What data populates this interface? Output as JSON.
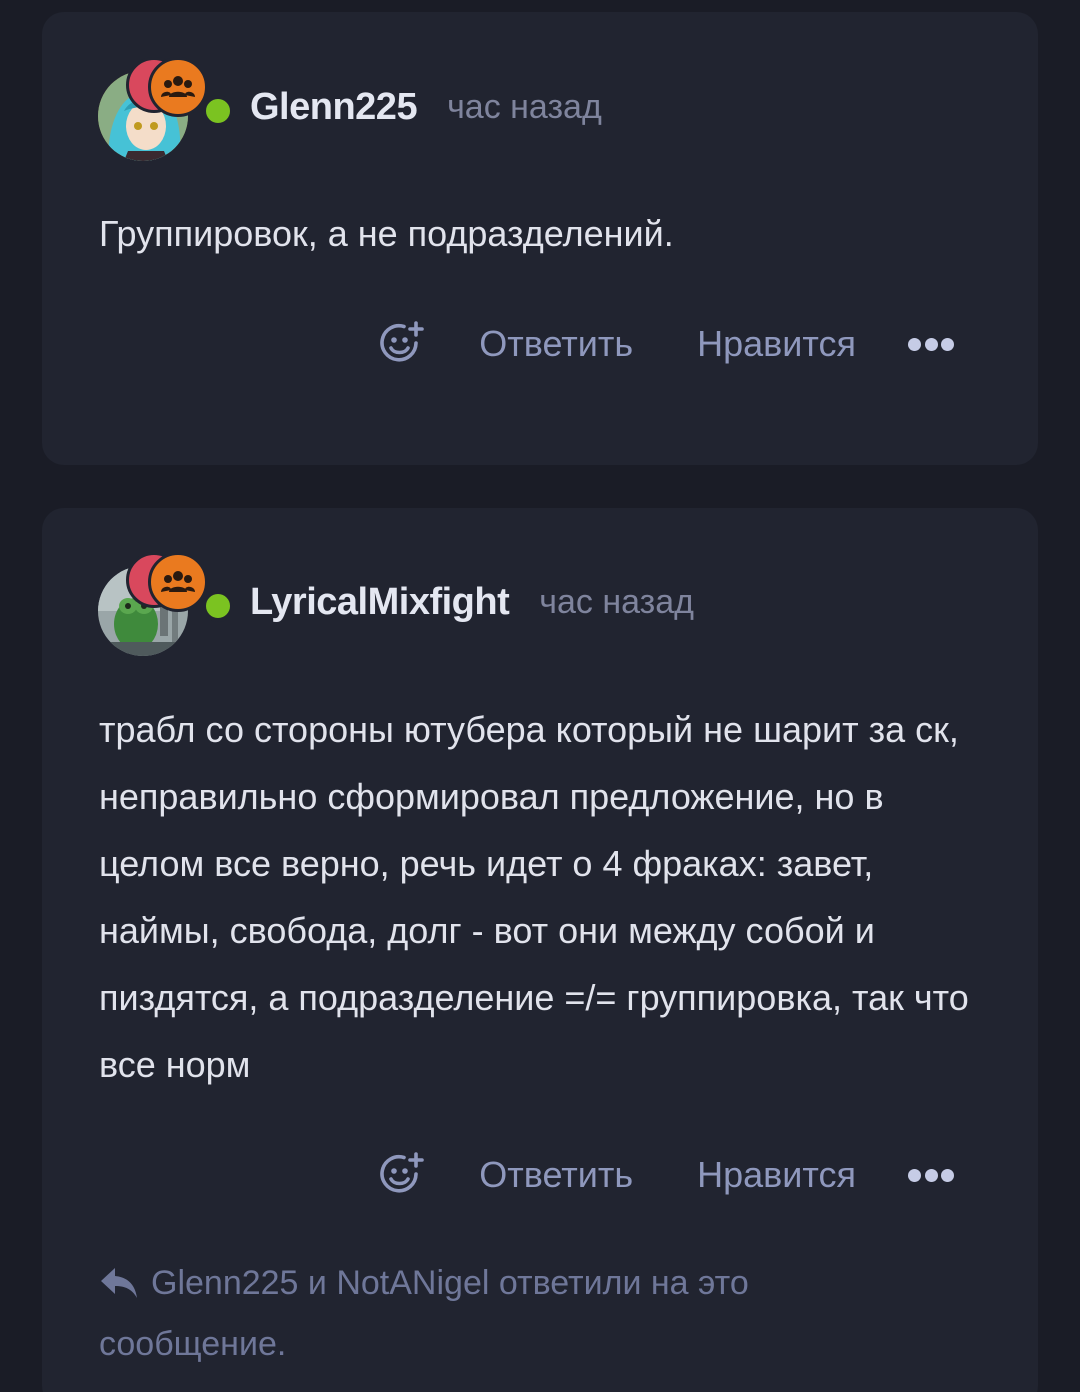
{
  "colors": {
    "page_background": "#1a1c26",
    "card_background": "#212430",
    "online": "#7bc321",
    "badge_red": "#d9485d",
    "badge_orange": "#ea7a1f",
    "action_text": "#8f98bd"
  },
  "comments": [
    {
      "username": "Glenn225",
      "time": "час назад",
      "online": true,
      "avatar": "anime-avatar",
      "badges": [
        "badge-red",
        "group-icon"
      ],
      "text": "Группировок, а не подразделений.",
      "actions": {
        "emoji_icon": "add-reaction-icon",
        "reply": "Ответить",
        "like": "Нравится",
        "more_icon": "more-dots-icon"
      }
    },
    {
      "username": "LyricalMixfight",
      "time": "час назад",
      "online": true,
      "avatar": "frog-avatar",
      "badges": [
        "badge-red",
        "group-icon"
      ],
      "text": "трабл со стороны ютубера который не шарит за ск, неправильно сформировал предложение, но в целом все верно, речь идет о 4 фраках: завет, наймы, свобода, долг - вот они между собой и пиздятся, а подразделение =/= группировка, так что все норм",
      "actions": {
        "emoji_icon": "add-reaction-icon",
        "reply": "Ответить",
        "like": "Нравится",
        "more_icon": "more-dots-icon"
      },
      "replies_note": "Glenn225 и NotANigel ответили на это сообщение."
    }
  ]
}
